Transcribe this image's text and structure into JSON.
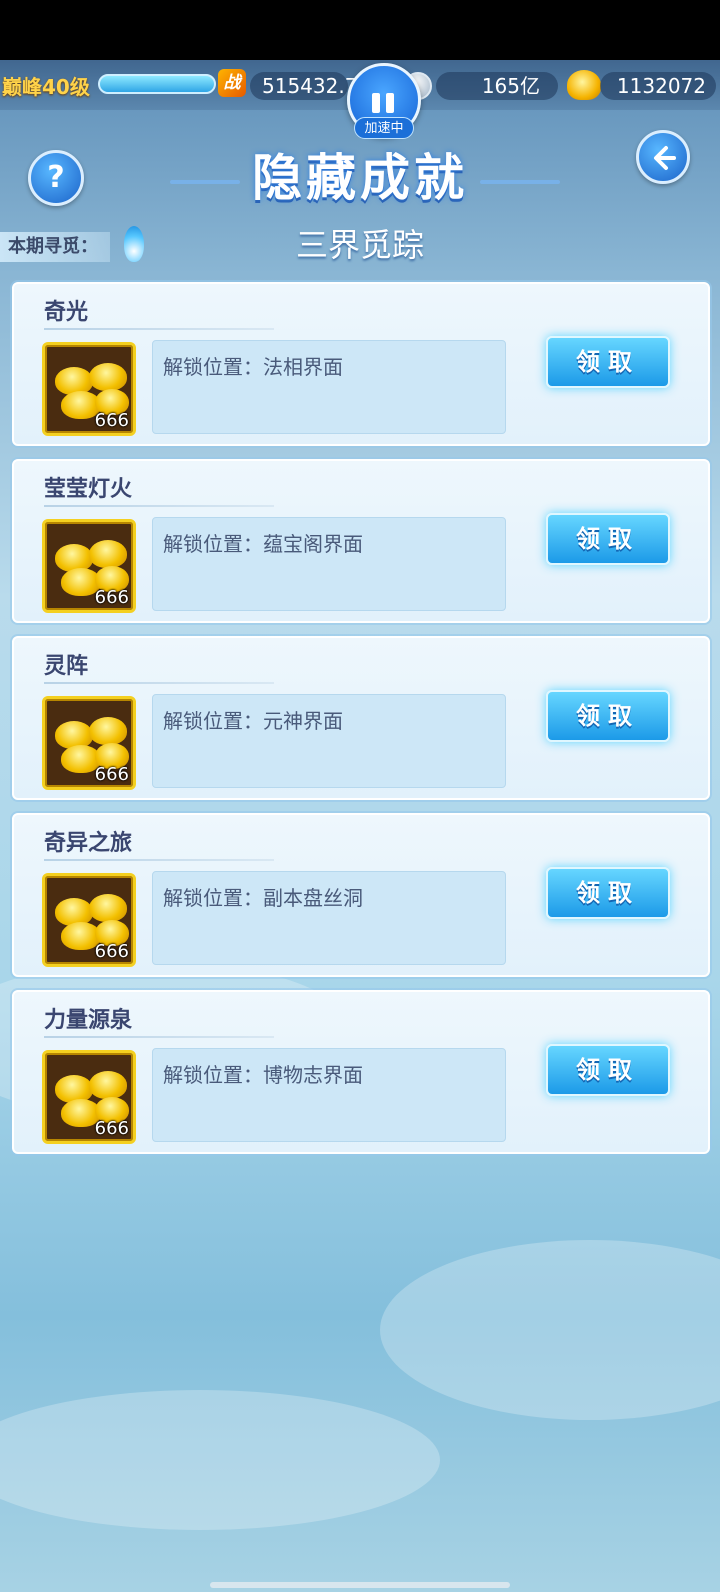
{
  "status": {
    "level": "巅峰40级",
    "power_icon": "战",
    "power": "515432.7",
    "silver": "165亿",
    "gold": "1132072"
  },
  "speed": {
    "label": "加速中"
  },
  "header": {
    "title": "隐藏成就",
    "help": "?"
  },
  "period": {
    "label": "本期寻觅：",
    "name": "三界觅踪"
  },
  "cards": [
    {
      "name": "奇光",
      "reward_count": "666",
      "desc": "解锁位置：法相界面",
      "button": "领取"
    },
    {
      "name": "莹莹灯火",
      "reward_count": "666",
      "desc": "解锁位置：蕴宝阁界面",
      "button": "领取"
    },
    {
      "name": "灵阵",
      "reward_count": "666",
      "desc": "解锁位置：元神界面",
      "button": "领取"
    },
    {
      "name": "奇异之旅",
      "reward_count": "666",
      "desc": "解锁位置：副本盘丝洞",
      "button": "领取"
    },
    {
      "name": "力量源泉",
      "reward_count": "666",
      "desc": "解锁位置：博物志界面",
      "button": "领取"
    }
  ]
}
